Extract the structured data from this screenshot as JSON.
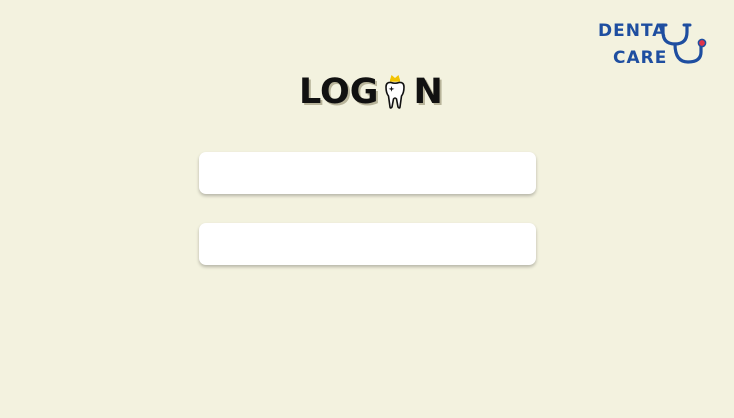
{
  "brand": {
    "line1": "DENTA",
    "line2": "CARE",
    "color": "#1e4ea0",
    "accent_dot": "#e0344a",
    "mark_icon": "stethoscope-icon"
  },
  "title": {
    "prefix": "LOG",
    "suffix": "N",
    "icon": "tooth-icon",
    "crown_color": "#f2c300"
  },
  "form": {
    "field_1": {
      "value": "",
      "placeholder": ""
    },
    "field_2": {
      "value": "",
      "placeholder": ""
    }
  },
  "colors": {
    "background": "#f3f2df",
    "field_background": "#ffffff"
  }
}
